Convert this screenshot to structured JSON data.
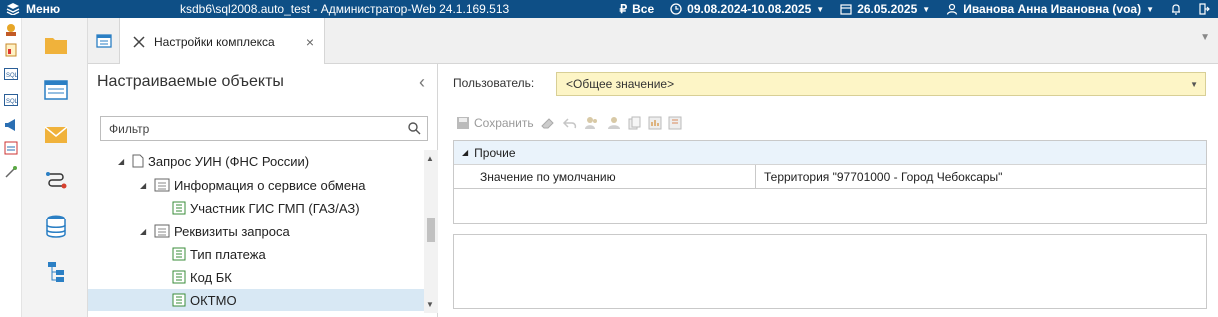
{
  "topbar": {
    "menu_label": "Меню",
    "window_title": "ksdb6\\sql2008.auto_test - Администратор-Web 24.1.169.513",
    "currency_symbol": "₽",
    "scope": "Все",
    "period": "09.08.2024-10.08.2025",
    "date": "26.05.2025",
    "user": "Иванова Анна Ивановна (voa)"
  },
  "tabs": {
    "active_label": "Настройки комплекса",
    "close_glyph": "×"
  },
  "tree_panel": {
    "title": "Настраиваемые объекты",
    "filter_placeholder": "Фильтр",
    "items": [
      {
        "label": "Запрос УИН (ФНС России)"
      },
      {
        "label": "Информация о сервисе обмена"
      },
      {
        "label": "Участник ГИС ГМП (ГАЗ/АЗ)"
      },
      {
        "label": "Реквизиты запроса"
      },
      {
        "label": "Тип платежа"
      },
      {
        "label": "Код БК"
      },
      {
        "label": "ОКТМО"
      }
    ]
  },
  "settings": {
    "user_label": "Пользователь:",
    "user_value": "<Общее значение>",
    "save_label": "Сохранить",
    "group_label": "Прочие",
    "rows": [
      {
        "name": "Значение по умолчанию",
        "value": "Территория \"97701000 - Город Чебоксары\""
      }
    ]
  },
  "icons": {
    "tiny_toolbar": [
      "tools-icon",
      "report-icon",
      "sql-icon",
      "sql-icon",
      "megaphone-icon",
      "calendar-icon",
      "wand-icon"
    ],
    "left_nav": [
      "folder-icon",
      "table-icon",
      "mail-icon",
      "workflow-icon",
      "database-icon",
      "hierarchy-icon"
    ]
  },
  "colors": {
    "topbar_bg": "#0e4f86",
    "selected_row": "#d8e8f4",
    "user_select_bg": "#fdf5c6",
    "group_bg": "#eaf3fb"
  }
}
